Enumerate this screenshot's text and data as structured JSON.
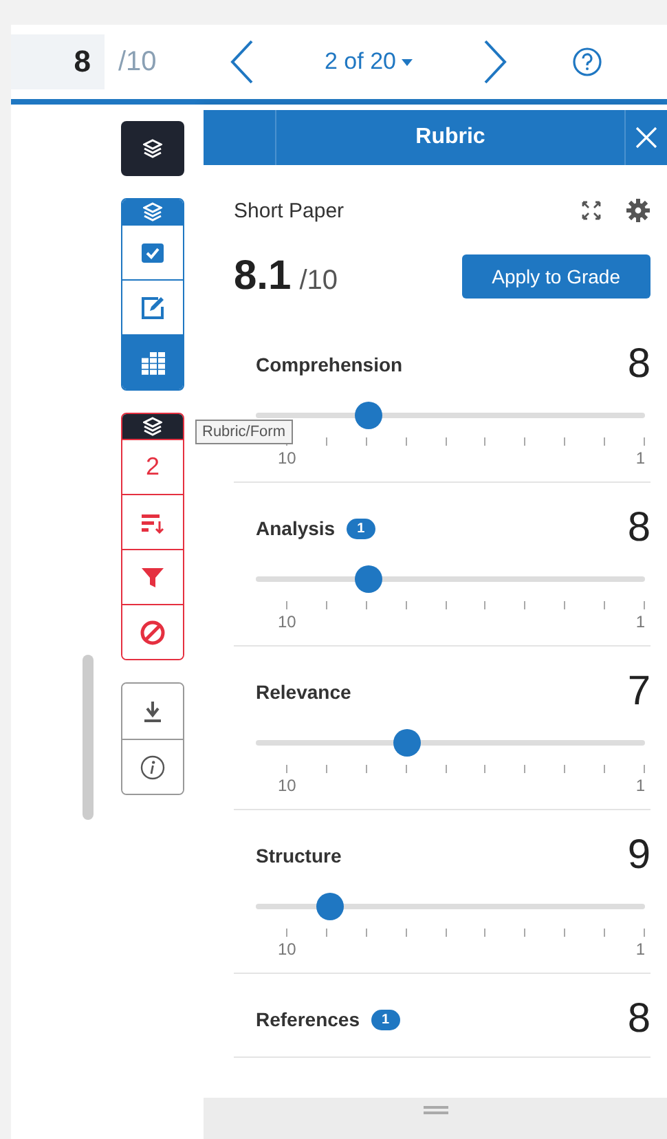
{
  "top_bar": {
    "score": "8",
    "score_max": "/10",
    "pager": "2 of 20"
  },
  "panel": {
    "title": "Rubric",
    "name": "Short Paper",
    "total": "8.1",
    "total_max": "/10",
    "apply_button": "Apply to Grade"
  },
  "toolbar": {
    "tooltip": "Rubric/Form",
    "tools": [
      {
        "kind": "check",
        "selected": false
      },
      {
        "kind": "edit",
        "selected": false
      },
      {
        "kind": "grid",
        "selected": true
      }
    ],
    "filter_count": "2"
  },
  "criteria": [
    {
      "name": "Comprehension",
      "score": "8",
      "level": 0.29,
      "min_label": "10",
      "max_label": "1"
    },
    {
      "name": "Analysis",
      "score": "8",
      "comments": "1",
      "level": 0.29,
      "min_label": "10",
      "max_label": "1"
    },
    {
      "name": "Relevance",
      "score": "7",
      "level": 0.39,
      "min_label": "10",
      "max_label": "1"
    },
    {
      "name": "Structure",
      "score": "9",
      "level": 0.19,
      "min_label": "10",
      "max_label": "1"
    },
    {
      "name": "References",
      "score": "8",
      "comments": "1"
    }
  ]
}
